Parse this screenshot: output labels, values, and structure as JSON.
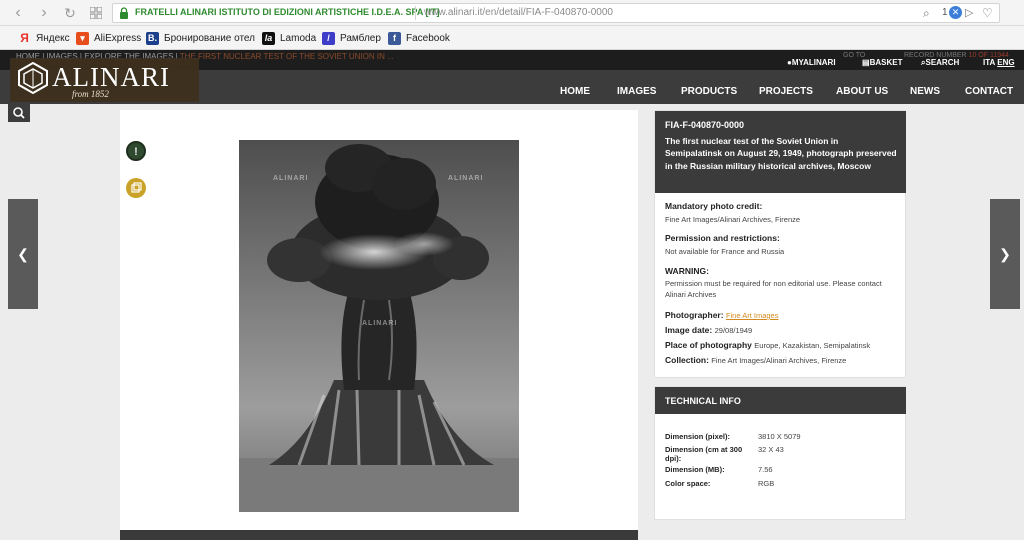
{
  "browser": {
    "site_name": "FRATELLI ALINARI ISTITUTO DI EDIZIONI ARTISTICHE I.D.E.A. SPA [IT]",
    "url": "www.alinari.it/en/detail/FIA-F-040870-0000",
    "badge_count": "1",
    "bookmarks": [
      {
        "label": "Яндекс",
        "icon": "yandex-icon",
        "color": "#e8322b"
      },
      {
        "label": "AliExpress",
        "icon": "aliexpress-icon",
        "color": "#e84d1c"
      },
      {
        "label": "Бронирование отел",
        "icon": "booking-icon",
        "color": "#1b3f8b"
      },
      {
        "label": "Lamoda",
        "icon": "lamoda-icon",
        "color": "#111111"
      },
      {
        "label": "Рамблер",
        "icon": "rambler-icon",
        "color": "#3d3dc8"
      },
      {
        "label": "Facebook",
        "icon": "facebook-icon",
        "color": "#3b5998"
      }
    ]
  },
  "header": {
    "breadcrumbs": [
      "HOME",
      "IMAGES",
      "EXPLORE THE IMAGES",
      "THE FIRST NUCLEAR TEST OF THE SOVIET UNION IN ..."
    ],
    "goto_label": "GO TO",
    "record_label": "RECORD NUMBER",
    "record_value": "10 OF 11944",
    "myalinari": "MYALINARI",
    "basket": "BASKET",
    "search": "SEARCH",
    "lang_ita": "ITA",
    "lang_eng": "ENG",
    "logo_name": "ALINARI",
    "logo_since": "from 1852",
    "nav": [
      "HOME",
      "IMAGES",
      "PRODUCTS",
      "PROJECTS",
      "ABOUT US",
      "NEWS",
      "CONTACT"
    ]
  },
  "photo": {
    "watermark": "ALINARI",
    "alert_color": "#2f4a2f",
    "copy_color": "#c9a227"
  },
  "details": {
    "code": "FIA-F-040870-0000",
    "title": "The first nuclear test of the Soviet Union in Semipalatinsk on August 29, 1949, photograph preserved in the Russian military historical archives, Moscow",
    "credit_label": "Mandatory photo credit:",
    "credit_value": "Fine Art Images/Alinari Archives, Firenze",
    "permission_label": "Permission and restrictions:",
    "permission_value": "Not available for France and Russia",
    "warning_label": "WARNING:",
    "warning_value": "Permission must be required for non editorial use. Please contact Alinari Archives",
    "photographer_label": "Photographer:",
    "photographer_value": "Fine Art Images",
    "date_label": "Image date:",
    "date_value": "29/08/1949",
    "place_label": "Place of photography",
    "place_value": "Europe, Kazakistan, Semipalatinsk",
    "collection_label": "Collection:",
    "collection_value": "Fine Art Images/Alinari Archives, Firenze"
  },
  "technical": {
    "title": "TECHNICAL INFO",
    "rows": [
      {
        "label": "Dimension (pixel):",
        "value": "3810 X 5079"
      },
      {
        "label": "Dimension (cm at 300 dpi):",
        "value": "32 X 43"
      },
      {
        "label": "Dimension (MB):",
        "value": "7.56"
      },
      {
        "label": "Color space:",
        "value": "RGB"
      }
    ]
  }
}
